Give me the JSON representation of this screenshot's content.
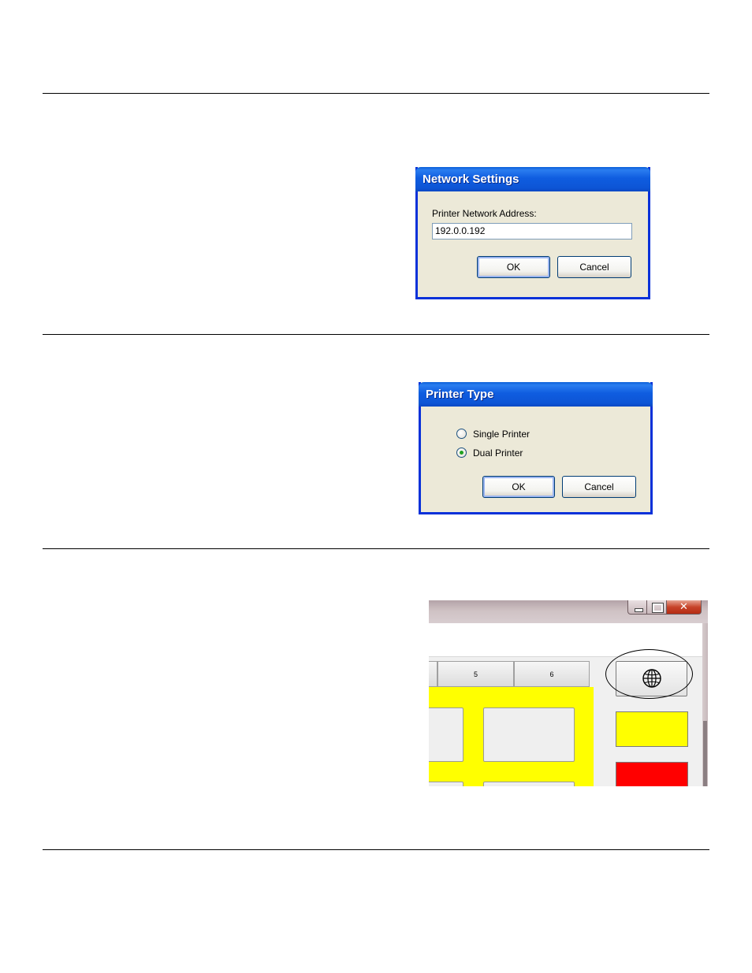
{
  "network_dialog": {
    "title": "Network Settings",
    "address_label": "Printer Network Address:",
    "address_value": "192.0.0.192",
    "ok_label": "OK",
    "cancel_label": "Cancel"
  },
  "printer_type_dialog": {
    "title": "Printer Type",
    "options": [
      {
        "label": "Single Printer",
        "selected": false
      },
      {
        "label": "Dual Printer",
        "selected": true
      }
    ],
    "ok_label": "OK",
    "cancel_label": "Cancel"
  },
  "app_window": {
    "tabs": [
      "5",
      "6"
    ],
    "network_button_icon": "globe-icon",
    "side_button_colors": [
      "#ffff00",
      "#ff0000"
    ],
    "panel_color": "#ffff00"
  }
}
